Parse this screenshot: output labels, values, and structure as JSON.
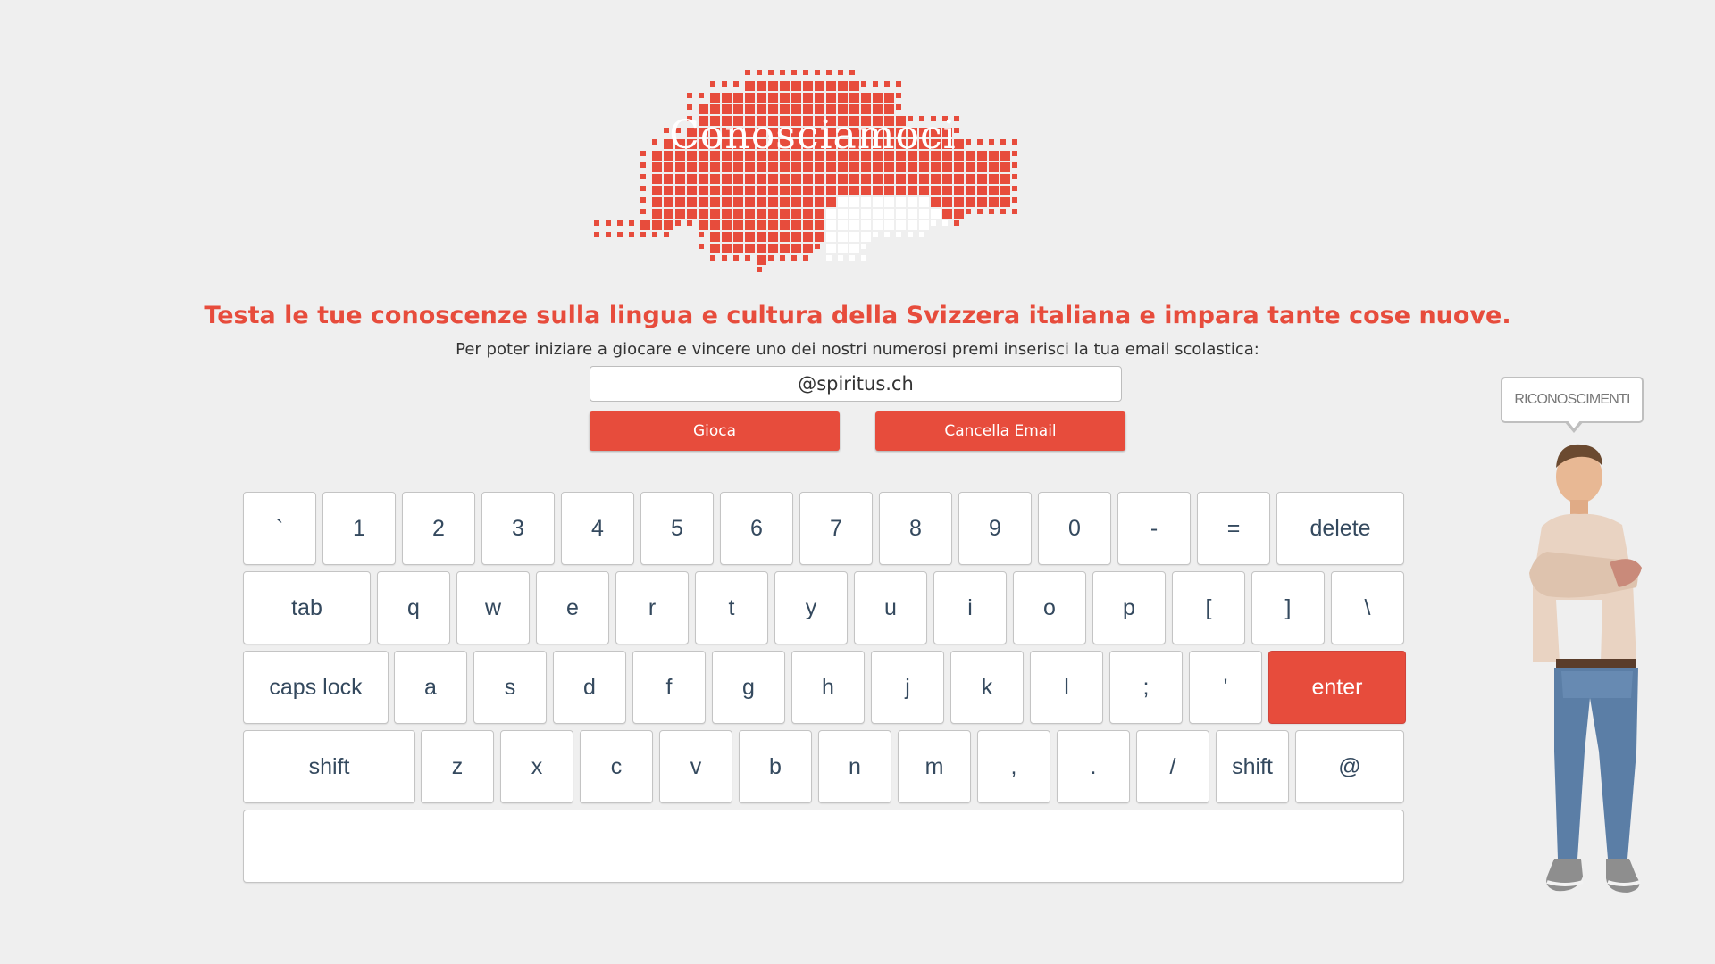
{
  "colors": {
    "accent": "#e74c3c",
    "background": "#efefef",
    "key_text": "#34495e"
  },
  "logo": {
    "title": "Conosciamoci",
    "icon": "switzerland-pixel-map-icon"
  },
  "intro": {
    "headline": "Testa le tue conoscenze sulla lingua e cultura della Svizzera italiana e impara tante cose nuove.",
    "instruction": "Per poter iniziare a giocare e vincere uno dei nostri numerosi premi inserisci la tua email scolastica:"
  },
  "email": {
    "value": "@spiritus.ch"
  },
  "buttons": {
    "play": "Gioca",
    "clear_email": "Cancella Email"
  },
  "keyboard": {
    "rows": [
      [
        "`",
        "1",
        "2",
        "3",
        "4",
        "5",
        "6",
        "7",
        "8",
        "9",
        "0",
        "-",
        "=",
        "delete"
      ],
      [
        "tab",
        "q",
        "w",
        "e",
        "r",
        "t",
        "y",
        "u",
        "i",
        "o",
        "p",
        "[",
        "]",
        "\\"
      ],
      [
        "caps lock",
        "a",
        "s",
        "d",
        "f",
        "g",
        "h",
        "j",
        "k",
        "l",
        ";",
        "'",
        "enter"
      ],
      [
        "shift",
        "z",
        "x",
        "c",
        "v",
        "b",
        "n",
        "m",
        ",",
        ".",
        "/",
        "shift",
        "@"
      ],
      [
        " "
      ]
    ],
    "highlighted": "enter"
  },
  "credits": {
    "label": "RICONOSCIMENTI",
    "icon": "mascot-person-icon"
  }
}
